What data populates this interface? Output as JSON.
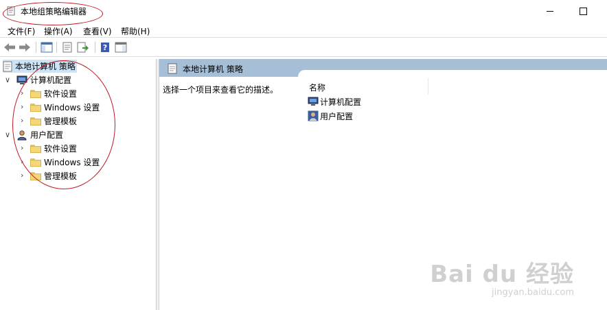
{
  "window": {
    "title": "本地组策略编辑器"
  },
  "menu": [
    "文件(F)",
    "操作(A)",
    "查看(V)",
    "帮助(H)"
  ],
  "toolbar": {
    "buttons": [
      "back-arrow-icon",
      "forward-arrow-icon",
      "show-hide-tree-icon",
      "properties-icon",
      "export-list-icon",
      "help-icon",
      "action-pane-icon"
    ]
  },
  "tree": {
    "root": "本地计算机 策略",
    "computer": {
      "label": "计算机配置",
      "children": [
        "软件设置",
        "Windows 设置",
        "管理模板"
      ]
    },
    "user": {
      "label": "用户配置",
      "children": [
        "软件设置",
        "Windows 设置",
        "管理模板"
      ]
    }
  },
  "content": {
    "header": "本地计算机 策略",
    "description": "选择一个项目来查看它的描述。",
    "column_name": "名称",
    "items": [
      "计算机配置",
      "用户配置"
    ]
  },
  "watermark": {
    "main": "Bai du 经验",
    "sub": "jingyan.baidu.com"
  },
  "colors": {
    "selection": "#cce4f7",
    "pane_header": "#a7bed7",
    "annotation": "#c0181f"
  }
}
